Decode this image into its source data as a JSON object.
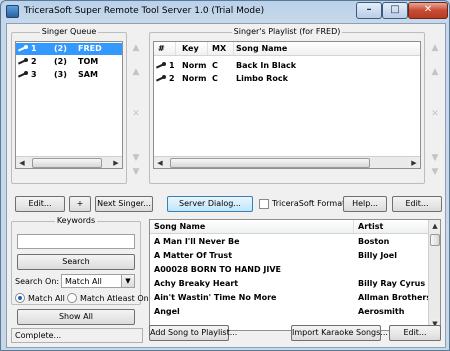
{
  "window": {
    "title": "TriceraSoft Super Remote Tool Server 1.0 (Trial Mode)"
  },
  "singer_queue": {
    "caption": "Singer Queue",
    "rows": [
      {
        "num": "1",
        "count": "(2)",
        "name": "FRED",
        "selected": true
      },
      {
        "num": "2",
        "count": "(2)",
        "name": "TOM",
        "selected": false
      },
      {
        "num": "3",
        "count": "(3)",
        "name": "SAM",
        "selected": false
      }
    ]
  },
  "playlist": {
    "caption": "Singer's Playlist (for FRED)",
    "columns": [
      "#",
      "Key",
      "MX",
      "Song Name"
    ],
    "rows": [
      {
        "num": "1",
        "key": "Norm",
        "mx": "C",
        "song": "Back In Black"
      },
      {
        "num": "2",
        "key": "Norm",
        "mx": "C",
        "song": "Limbo Rock"
      }
    ]
  },
  "tools": {
    "up_top": "▲",
    "up": "▲",
    "remove": "✕",
    "down": "▼",
    "down_bottom": "▼"
  },
  "buttons": {
    "edit": "Edit...",
    "plus": "+",
    "next_singer": "Next Singer...",
    "server_dialog": "Server Dialog...",
    "tricerasoft_format": "TriceraSoft Format",
    "help": "Help...",
    "edit_playlist": "Edit...",
    "search": "Search",
    "show_all": "Show All",
    "add_song": "Add Song to Playlist...",
    "import_songs": "Import Karaoke Songs...",
    "edit_songs": "Edit..."
  },
  "keywords": {
    "caption": "Keywords",
    "value": ""
  },
  "search_on": {
    "label": "Search On:",
    "selected": "Match All"
  },
  "match_mode": {
    "match_all": "Match All",
    "match_atleast_one": "Match Atleast One",
    "selected": "match_all"
  },
  "song_list": {
    "columns": [
      "Song Name",
      "Artist"
    ],
    "rows": [
      {
        "song": "A Man I'll Never Be",
        "artist": "Boston"
      },
      {
        "song": "A Matter Of Trust",
        "artist": "Billy Joel"
      },
      {
        "song": "A00028 BORN TO HAND JIVE",
        "artist": ""
      },
      {
        "song": "Achy Breaky Heart",
        "artist": "Billy Ray Cyrus"
      },
      {
        "song": "Ain't Wastin' Time No More",
        "artist": "Allman Brothers"
      },
      {
        "song": "Angel",
        "artist": "Aerosmith"
      }
    ]
  },
  "status": {
    "text": "Complete..."
  }
}
